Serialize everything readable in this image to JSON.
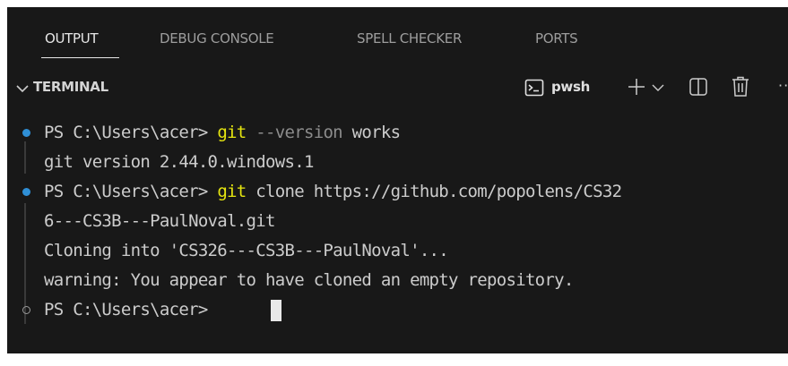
{
  "panel_tabs": [
    {
      "label": "OUTPUT",
      "active": true
    },
    {
      "label": "DEBUG CONSOLE",
      "active": false
    },
    {
      "label": "SPELL CHECKER",
      "active": false
    },
    {
      "label": "PORTS",
      "active": false
    }
  ],
  "terminal": {
    "title": "TERMINAL",
    "shell_label": "pwsh",
    "actions": [
      "terminal-icon",
      "plus-icon",
      "chevron-down-icon",
      "split-icon",
      "trash-icon",
      "more-icon"
    ],
    "more_glyph": "···"
  },
  "lines": [
    {
      "prompt": "PS C:\\Users\\acer> ",
      "cmd": "git",
      "param": " --version",
      "arg": " works"
    },
    {
      "text": "git version 2.44.0.windows.1"
    },
    {
      "prompt": "PS C:\\Users\\acer> ",
      "cmd": "git",
      "param": "",
      "arg": " clone https://github.com/popolens/CS32"
    },
    {
      "text": "6---CS3B---PaulNoval.git"
    },
    {
      "text": "Cloning into 'CS326---CS3B---PaulNoval'..."
    },
    {
      "text": "warning: You appear to have cloned an empty repository."
    },
    {
      "prompt": "PS C:\\Users\\acer> ",
      "cmd": "",
      "param": "",
      "arg": ""
    }
  ],
  "colors": {
    "panel_bg": "#181818",
    "command_yellow": "#e5e510",
    "decoration_blue": "#2f8fd6"
  }
}
